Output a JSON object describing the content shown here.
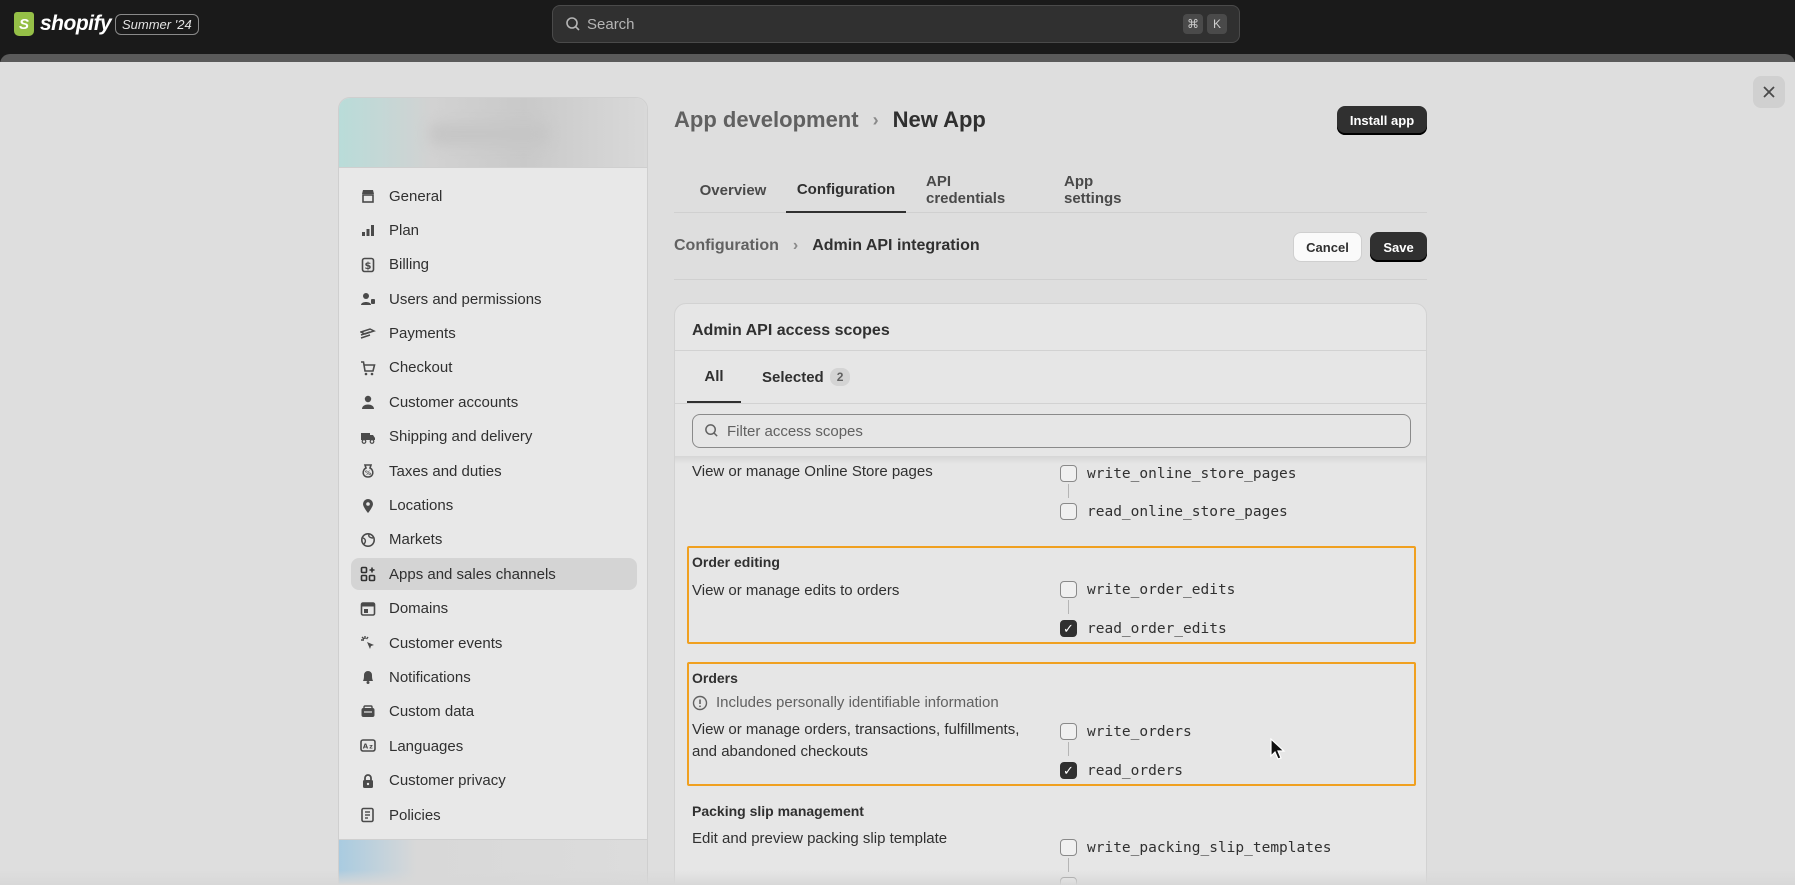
{
  "topbar": {
    "brand": "shopify",
    "brand_letter": "S",
    "edition_badge": "Summer '24",
    "search_placeholder": "Search",
    "shortcut_keys": [
      "⌘",
      "K"
    ]
  },
  "sidebar": {
    "items": [
      {
        "label": "General",
        "icon": "store-icon"
      },
      {
        "label": "Plan",
        "icon": "chart-icon"
      },
      {
        "label": "Billing",
        "icon": "dollar-icon"
      },
      {
        "label": "Users and permissions",
        "icon": "users-icon"
      },
      {
        "label": "Payments",
        "icon": "payments-icon"
      },
      {
        "label": "Checkout",
        "icon": "cart-icon"
      },
      {
        "label": "Customer accounts",
        "icon": "person-icon"
      },
      {
        "label": "Shipping and delivery",
        "icon": "truck-icon"
      },
      {
        "label": "Taxes and duties",
        "icon": "tax-icon"
      },
      {
        "label": "Locations",
        "icon": "location-icon"
      },
      {
        "label": "Markets",
        "icon": "globe-icon"
      },
      {
        "label": "Apps and sales channels",
        "icon": "apps-icon",
        "active": true
      },
      {
        "label": "Domains",
        "icon": "domain-icon"
      },
      {
        "label": "Customer events",
        "icon": "cursor-click-icon"
      },
      {
        "label": "Notifications",
        "icon": "bell-icon"
      },
      {
        "label": "Custom data",
        "icon": "database-icon"
      },
      {
        "label": "Languages",
        "icon": "language-icon"
      },
      {
        "label": "Customer privacy",
        "icon": "lock-icon"
      },
      {
        "label": "Policies",
        "icon": "policy-icon"
      }
    ]
  },
  "header": {
    "breadcrumb_parent": "App development",
    "breadcrumb_separator": "›",
    "title": "New App",
    "install_button": "Install app"
  },
  "tabs": [
    "Overview",
    "Configuration",
    "API credentials",
    "App settings"
  ],
  "active_tab": "Configuration",
  "subheader": {
    "breadcrumb_parent": "Configuration",
    "breadcrumb_separator": "›",
    "title": "Admin API integration",
    "cancel_button": "Cancel",
    "save_button": "Save"
  },
  "scopes_card": {
    "title": "Admin API access scopes",
    "tab_all": "All",
    "tab_selected": "Selected",
    "selected_count": "2",
    "filter_placeholder": "Filter access scopes",
    "sections": [
      {
        "title": "",
        "description": "View or manage Online Store pages",
        "scopes": [
          {
            "name": "write_online_store_pages",
            "checked": false
          },
          {
            "name": "read_online_store_pages",
            "checked": false
          }
        ]
      },
      {
        "title": "Order editing",
        "description": "View or manage edits to orders",
        "highlighted": true,
        "scopes": [
          {
            "name": "write_order_edits",
            "checked": false
          },
          {
            "name": "read_order_edits",
            "checked": true
          }
        ]
      },
      {
        "title": "Orders",
        "notice": "Includes personally identifiable information",
        "description_line1": "View or manage orders, transactions, fulfillments,",
        "description_line2": "and abandoned checkouts",
        "highlighted": true,
        "scopes": [
          {
            "name": "write_orders",
            "checked": false
          },
          {
            "name": "read_orders",
            "checked": true
          }
        ]
      },
      {
        "title": "Packing slip management",
        "description": "Edit and preview packing slip template",
        "scopes": [
          {
            "name": "write_packing_slip_templates",
            "checked": false
          }
        ]
      }
    ]
  },
  "colors": {
    "brand_green": "#95bf47",
    "highlight": "#f0a020",
    "primary_button": "#303030"
  }
}
